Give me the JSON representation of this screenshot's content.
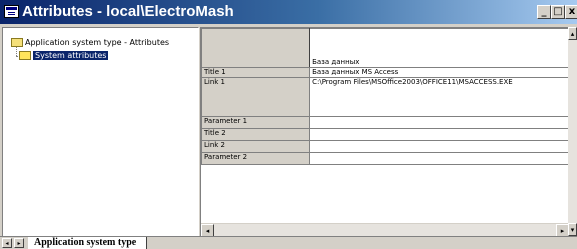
{
  "window": {
    "title": "Attributes - local\\ElectroMash",
    "controls": {
      "minimize": "_",
      "maximize": "□",
      "close": "x"
    }
  },
  "tree": {
    "root_label": "Application system type - Attributes",
    "child_label": "System attributes"
  },
  "grid": {
    "column_header": "База данных",
    "rows": [
      {
        "label": "Title 1",
        "value": "База данных MS Access"
      },
      {
        "label": "Link 1",
        "value": "C:\\Program Files\\MSOffice2003\\OFFICE11\\MSACCESS.EXE"
      },
      {
        "label": "Parameter 1",
        "value": ""
      },
      {
        "label": "Title 2",
        "value": ""
      },
      {
        "label": "Link 2",
        "value": ""
      },
      {
        "label": "Parameter 2",
        "value": ""
      }
    ],
    "scroll_left": "◂",
    "scroll_right": "▸",
    "scroll_up": "▴",
    "scroll_down": "▾"
  },
  "tabs": {
    "nav_prev": "◂",
    "nav_next": "▸",
    "active_tab": "Application system type"
  },
  "colors": {
    "titlebar_start": "#0a246a",
    "titlebar_end": "#a6caf0",
    "selection": "#0a246a",
    "face": "#d4d0c8"
  }
}
